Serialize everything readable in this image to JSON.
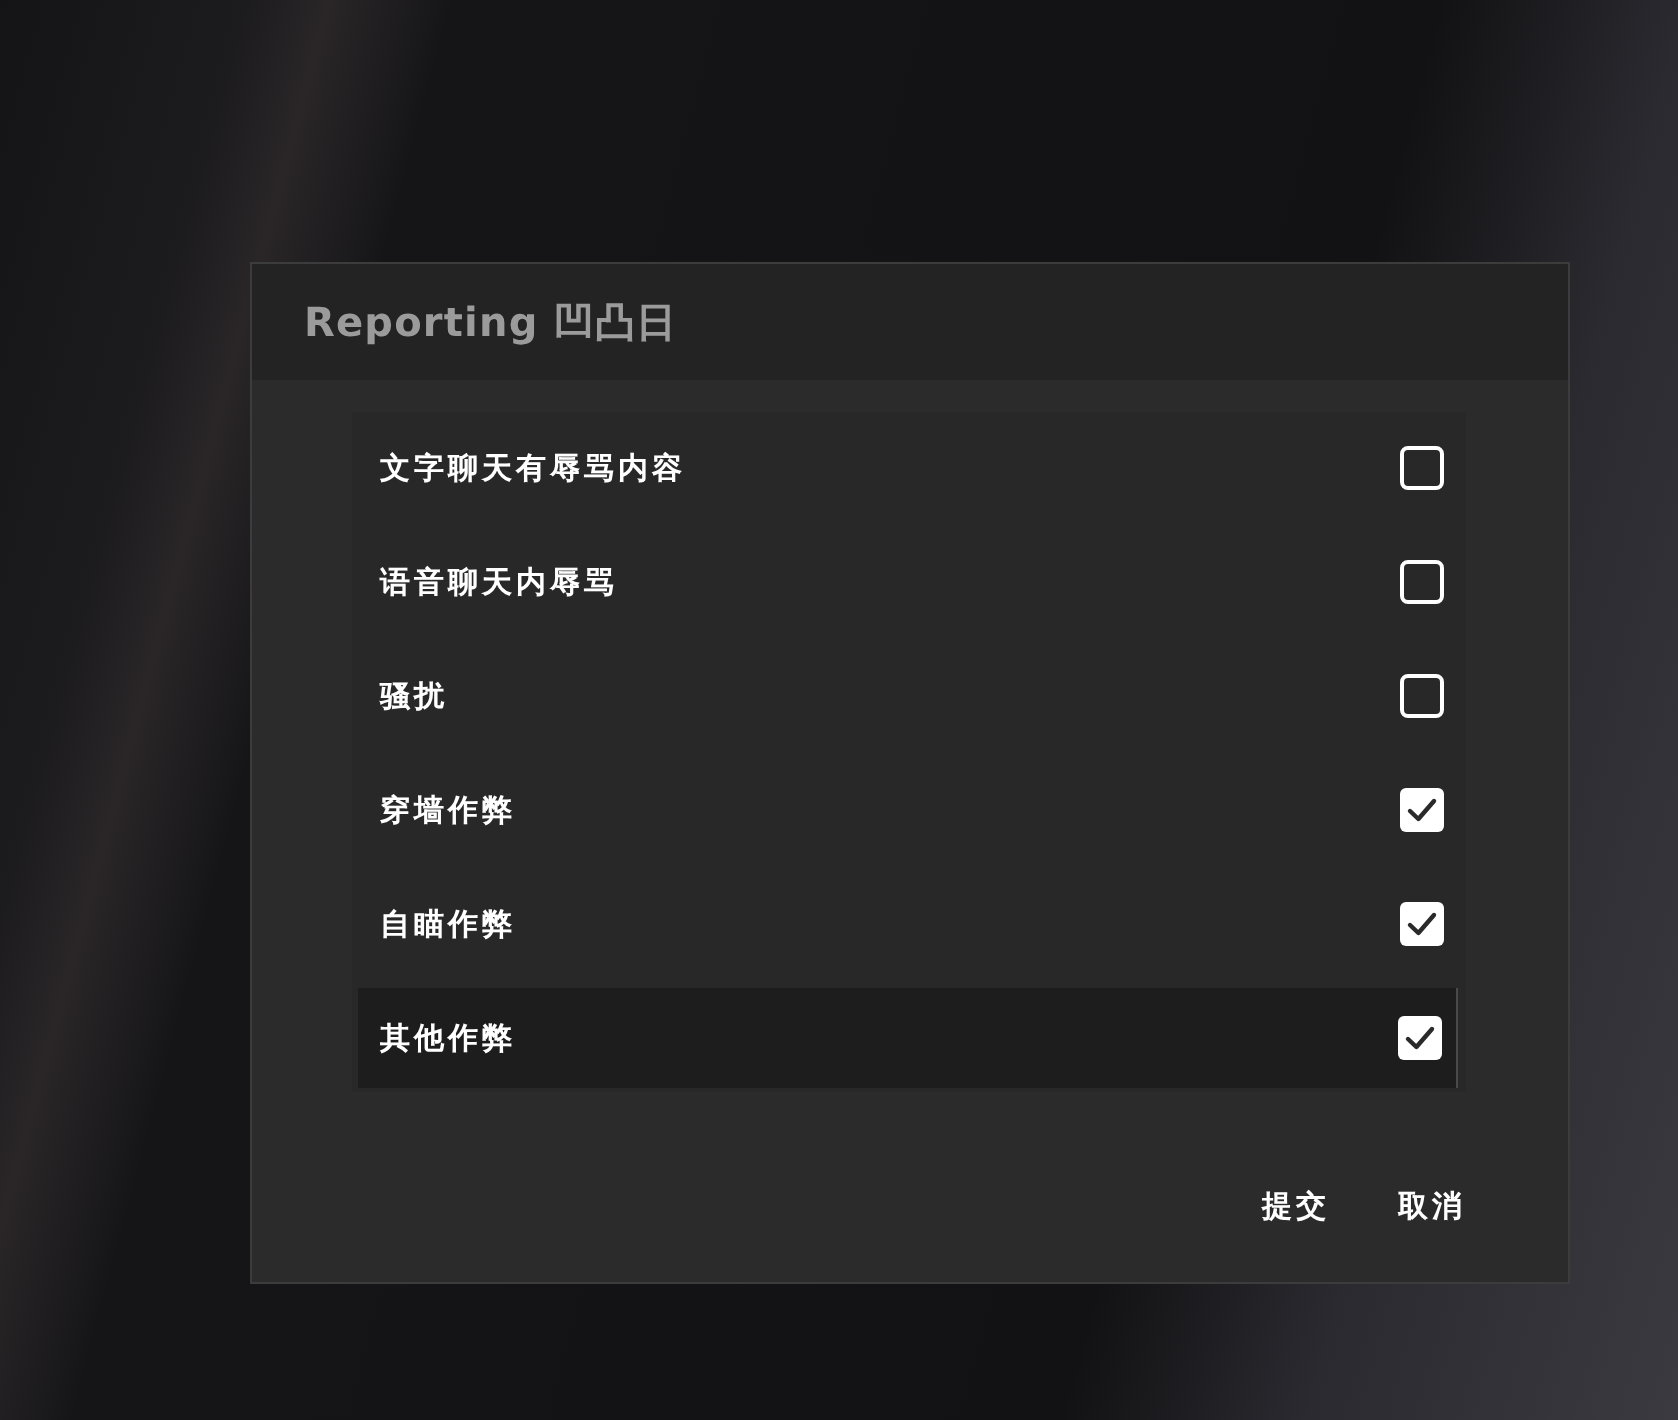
{
  "dialog": {
    "title": "Reporting 凹凸日",
    "reasons": [
      {
        "label": "文字聊天有辱骂内容",
        "checked": false,
        "highlighted": false
      },
      {
        "label": "语音聊天内辱骂",
        "checked": false,
        "highlighted": false
      },
      {
        "label": "骚扰",
        "checked": false,
        "highlighted": false
      },
      {
        "label": "穿墙作弊",
        "checked": true,
        "highlighted": false
      },
      {
        "label": "自瞄作弊",
        "checked": true,
        "highlighted": false
      },
      {
        "label": "其他作弊",
        "checked": true,
        "highlighted": true
      }
    ],
    "buttons": [
      "提交",
      "取消"
    ]
  }
}
